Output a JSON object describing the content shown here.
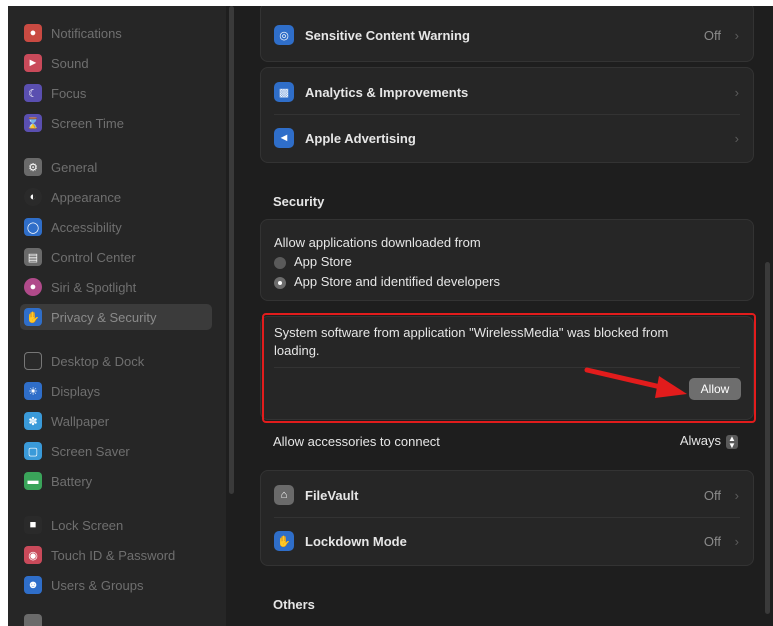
{
  "sidebar": {
    "items": [
      {
        "label": "Notifications",
        "icon": "bell-icon",
        "color": "#c94a42"
      },
      {
        "label": "Sound",
        "icon": "speaker-icon",
        "color": "#c94a5a"
      },
      {
        "label": "Focus",
        "icon": "moon-icon",
        "color": "#5a4fb0"
      },
      {
        "label": "Screen Time",
        "icon": "hourglass-icon",
        "color": "#5a4fb0"
      },
      {
        "label": "General",
        "icon": "gear-icon",
        "color": "#6a6a6a"
      },
      {
        "label": "Appearance",
        "icon": "appearance-icon",
        "color": "#2a2a2a"
      },
      {
        "label": "Accessibility",
        "icon": "accessibility-icon",
        "color": "#2f6ec9"
      },
      {
        "label": "Control Center",
        "icon": "control-center-icon",
        "color": "#6a6a6a"
      },
      {
        "label": "Siri & Spotlight",
        "icon": "siri-icon",
        "color": "#b04a8a"
      },
      {
        "label": "Privacy & Security",
        "icon": "hand-icon",
        "color": "#2f6ec9",
        "selected": true
      },
      {
        "label": "Desktop & Dock",
        "icon": "dock-icon",
        "color": "#2a2a2a"
      },
      {
        "label": "Displays",
        "icon": "display-icon",
        "color": "#2f6ec9"
      },
      {
        "label": "Wallpaper",
        "icon": "wallpaper-icon",
        "color": "#3a9ad9"
      },
      {
        "label": "Screen Saver",
        "icon": "screensaver-icon",
        "color": "#3a9ad9"
      },
      {
        "label": "Battery",
        "icon": "battery-icon",
        "color": "#3aa45a"
      },
      {
        "label": "Lock Screen",
        "icon": "lock-icon",
        "color": "#2a2a2a"
      },
      {
        "label": "Touch ID & Password",
        "icon": "fingerprint-icon",
        "color": "#c94a5a"
      },
      {
        "label": "Users & Groups",
        "icon": "users-icon",
        "color": "#2f6ec9"
      }
    ]
  },
  "main": {
    "sensitive": {
      "label": "Sensitive Content Warning",
      "value": "Off"
    },
    "analytics": {
      "label": "Analytics & Improvements"
    },
    "advertising": {
      "label": "Apple Advertising"
    },
    "security_title": "Security",
    "downloads": {
      "label": "Allow applications downloaded from",
      "option1": "App Store",
      "option2": "App Store and identified developers"
    },
    "blocked": {
      "message": "System software from application \"WirelessMedia\" was blocked from loading.",
      "allow_label": "Allow"
    },
    "accessories": {
      "label": "Allow accessories to connect",
      "value": "Always"
    },
    "filevault": {
      "label": "FileVault",
      "value": "Off"
    },
    "lockdown": {
      "label": "Lockdown Mode",
      "value": "Off"
    },
    "others_title": "Others"
  },
  "colors": {
    "annotation": "#e21c1c",
    "accent": "#2f6ec9"
  }
}
